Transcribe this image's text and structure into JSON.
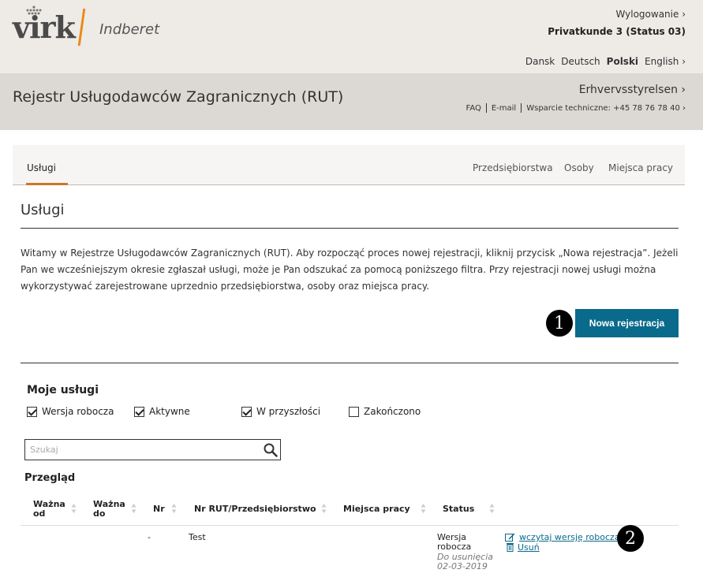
{
  "header": {
    "logo_text": "virk",
    "logo_sub": "Indberet",
    "logout": "Wylogowanie ›",
    "user": "Privatkunde 3 (Status 03)",
    "languages": [
      {
        "label": "Dansk",
        "active": false
      },
      {
        "label": "Deutsch",
        "active": false
      },
      {
        "label": "Polski",
        "active": true
      },
      {
        "label": "English ›",
        "active": false
      }
    ]
  },
  "band": {
    "title": "Rejestr Usługodawców Zagranicznych (RUT)",
    "agency": "Erhvervsstyrelsen ›",
    "faq": "FAQ",
    "email": "E-mail",
    "support": "Wsparcie techniczne: +45 78 76 78 40 ›"
  },
  "tabs": {
    "left": "Usługi",
    "right": [
      "Przedsiębiorstwa",
      "Osoby",
      "Miejsca pracy"
    ]
  },
  "main": {
    "heading": "Usługi",
    "intro": "Witamy w Rejestrze Usługodawców Zagranicznych (RUT). Aby rozpocząć proces nowej rejestracji, kliknij przycisk „Nowa rejestracja”. Jeżeli Pan we wcześniejszym okresie zgłaszał usługi, może je Pan odszukać za pomocą poniższego filtra. Przy rejestracji nowej usługi można wykorzystywać zarejestrowane uprzednio przedsiębiorstwa, osoby oraz miejsca pracy.",
    "new_button": "Nowa rejestracja",
    "markers": [
      "1",
      "2"
    ]
  },
  "services": {
    "heading": "Moje usługi",
    "filters": [
      {
        "label": "Wersja robocza",
        "checked": true
      },
      {
        "label": "Aktywne",
        "checked": true
      },
      {
        "label": "W przyszłości",
        "checked": true
      },
      {
        "label": "Zakończono",
        "checked": false
      }
    ],
    "search_placeholder": "Szukaj",
    "overview": "Przegląd",
    "columns": [
      "Ważna od",
      "Ważna do",
      "Nr",
      "Nr RUT/Przedsiębiorstwo",
      "Miejsca pracy",
      "Status"
    ],
    "rows": [
      {
        "valid_from": "",
        "valid_to": "",
        "nr": "-",
        "rut": "Test",
        "workplace": "",
        "status": "Wersja robocza",
        "status_note": "Do usunięcia 02-03-2019",
        "action_load": "wczytaj wersję roboczą",
        "action_delete": "Usuń"
      }
    ]
  },
  "colors": {
    "accent": "#0a6a8c",
    "logo_bar": "#e98a1c",
    "tab_underline": "#c9772a"
  }
}
